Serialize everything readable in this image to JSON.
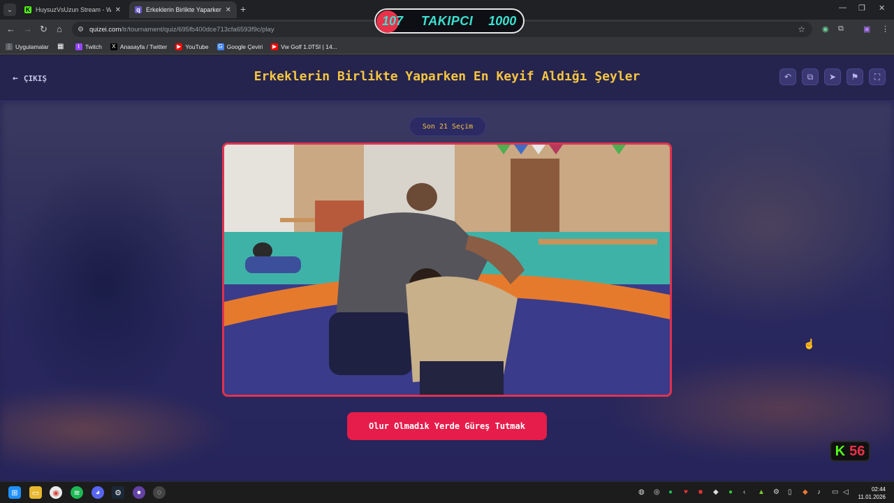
{
  "browser": {
    "tabs": [
      {
        "title": "HuysuzVsUzun Stream - Watch",
        "favicon": "K",
        "active": false
      },
      {
        "title": "Erkeklerin Birlikte Yaparken En",
        "favicon": "q",
        "active": true
      }
    ],
    "url": {
      "domain": "quizei.com",
      "path": "/tr/tournament/quiz/695fb400dce713cfa6593f9c/play"
    },
    "bookmarks": [
      {
        "label": "Uygulamalar",
        "icon": "apps-icon"
      },
      {
        "label": "Twitch",
        "icon": "twitch-icon"
      },
      {
        "label": "Anasayfa / Twitter",
        "icon": "x-icon"
      },
      {
        "label": "YouTube",
        "icon": "youtube-icon"
      },
      {
        "label": "Google Çeviri",
        "icon": "translate-icon"
      },
      {
        "label": "Vw Golf 1.0TSI | 14...",
        "icon": "youtube-icon"
      }
    ]
  },
  "follow_overlay": {
    "current": "107",
    "label": "TAKIPCI",
    "goal": "1000"
  },
  "page": {
    "back_label": "ÇIKIŞ",
    "title": "Erkeklerin Birlikte Yaparken En Keyif Aldığı Şeyler",
    "round_label": "Son 21 Seçim",
    "choice_label": "Olur Olmadık Yerde Güreş Tutmak",
    "header_icons": [
      "undo-icon",
      "copy-icon",
      "share-icon",
      "flag-icon",
      "fullscreen-icon"
    ]
  },
  "kick_badge": {
    "letter": "K",
    "count": "56"
  },
  "taskbar": {
    "time": "02:44",
    "date": "11.01.2026"
  },
  "colors": {
    "title": "#f5c542",
    "accent": "#e61c4a",
    "page_bg": "#2a2755"
  }
}
